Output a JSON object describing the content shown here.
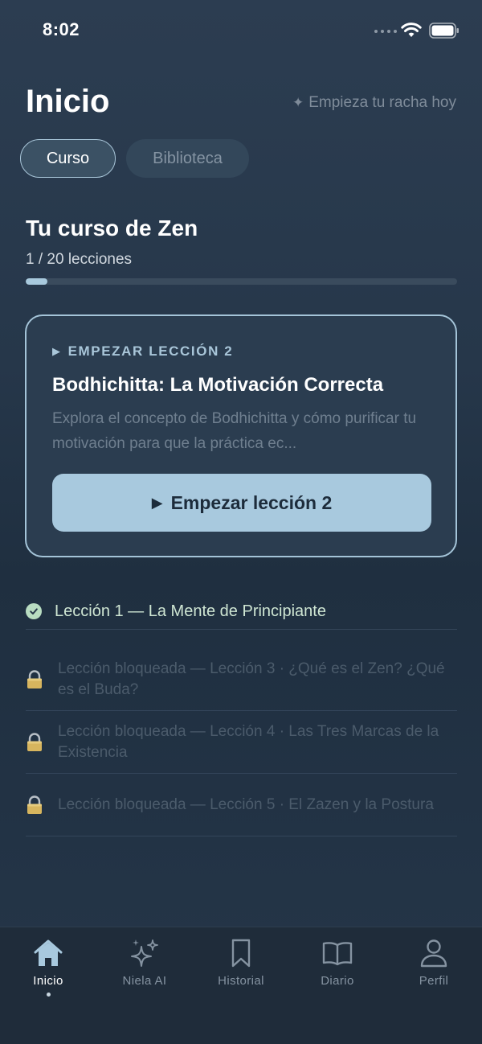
{
  "status_bar": {
    "time": "8:02"
  },
  "header": {
    "title": "Inicio",
    "streak_label": "Empieza tu racha hoy"
  },
  "tabs": [
    {
      "label": "Curso"
    },
    {
      "label": "Biblioteca"
    }
  ],
  "course": {
    "title": "Tu curso de Zen",
    "progress_text": "1 / 20 lecciones",
    "progress_fraction": 0.05
  },
  "lesson_card": {
    "eyebrow": "EMPEZAR LECCIÓN 2",
    "title": "Bodhichitta: La Motivación Correcta",
    "description": "Explora el concepto de Bodhichitta y cómo purificar tu motivación para que la práctica ec...",
    "button_label": "Empezar lección 2"
  },
  "lessons": {
    "completed": [
      {
        "label": "Lección 1 — La Mente de Principiante"
      }
    ],
    "locked": [
      {
        "label": "Lección bloqueada — Lección 3 · ¿Qué es el Zen? ¿Qué es el Buda?"
      },
      {
        "label": "Lección bloqueada — Lección 4 · Las Tres Marcas de la Existencia"
      },
      {
        "label": "Lección bloqueada — Lección 5 · El Zazen y la Postura"
      }
    ]
  },
  "bottom_nav": [
    {
      "label": "Inicio",
      "icon": "home-icon",
      "active": true
    },
    {
      "label": "Niela AI",
      "icon": "sparkles-icon",
      "active": false
    },
    {
      "label": "Historial",
      "icon": "bookmark-icon",
      "active": false
    },
    {
      "label": "Diario",
      "icon": "book-icon",
      "active": false
    },
    {
      "label": "Perfil",
      "icon": "person-icon",
      "active": false
    }
  ],
  "colors": {
    "accent": "#a8c9de",
    "background": "#26374a",
    "success": "#b8dcc1"
  }
}
